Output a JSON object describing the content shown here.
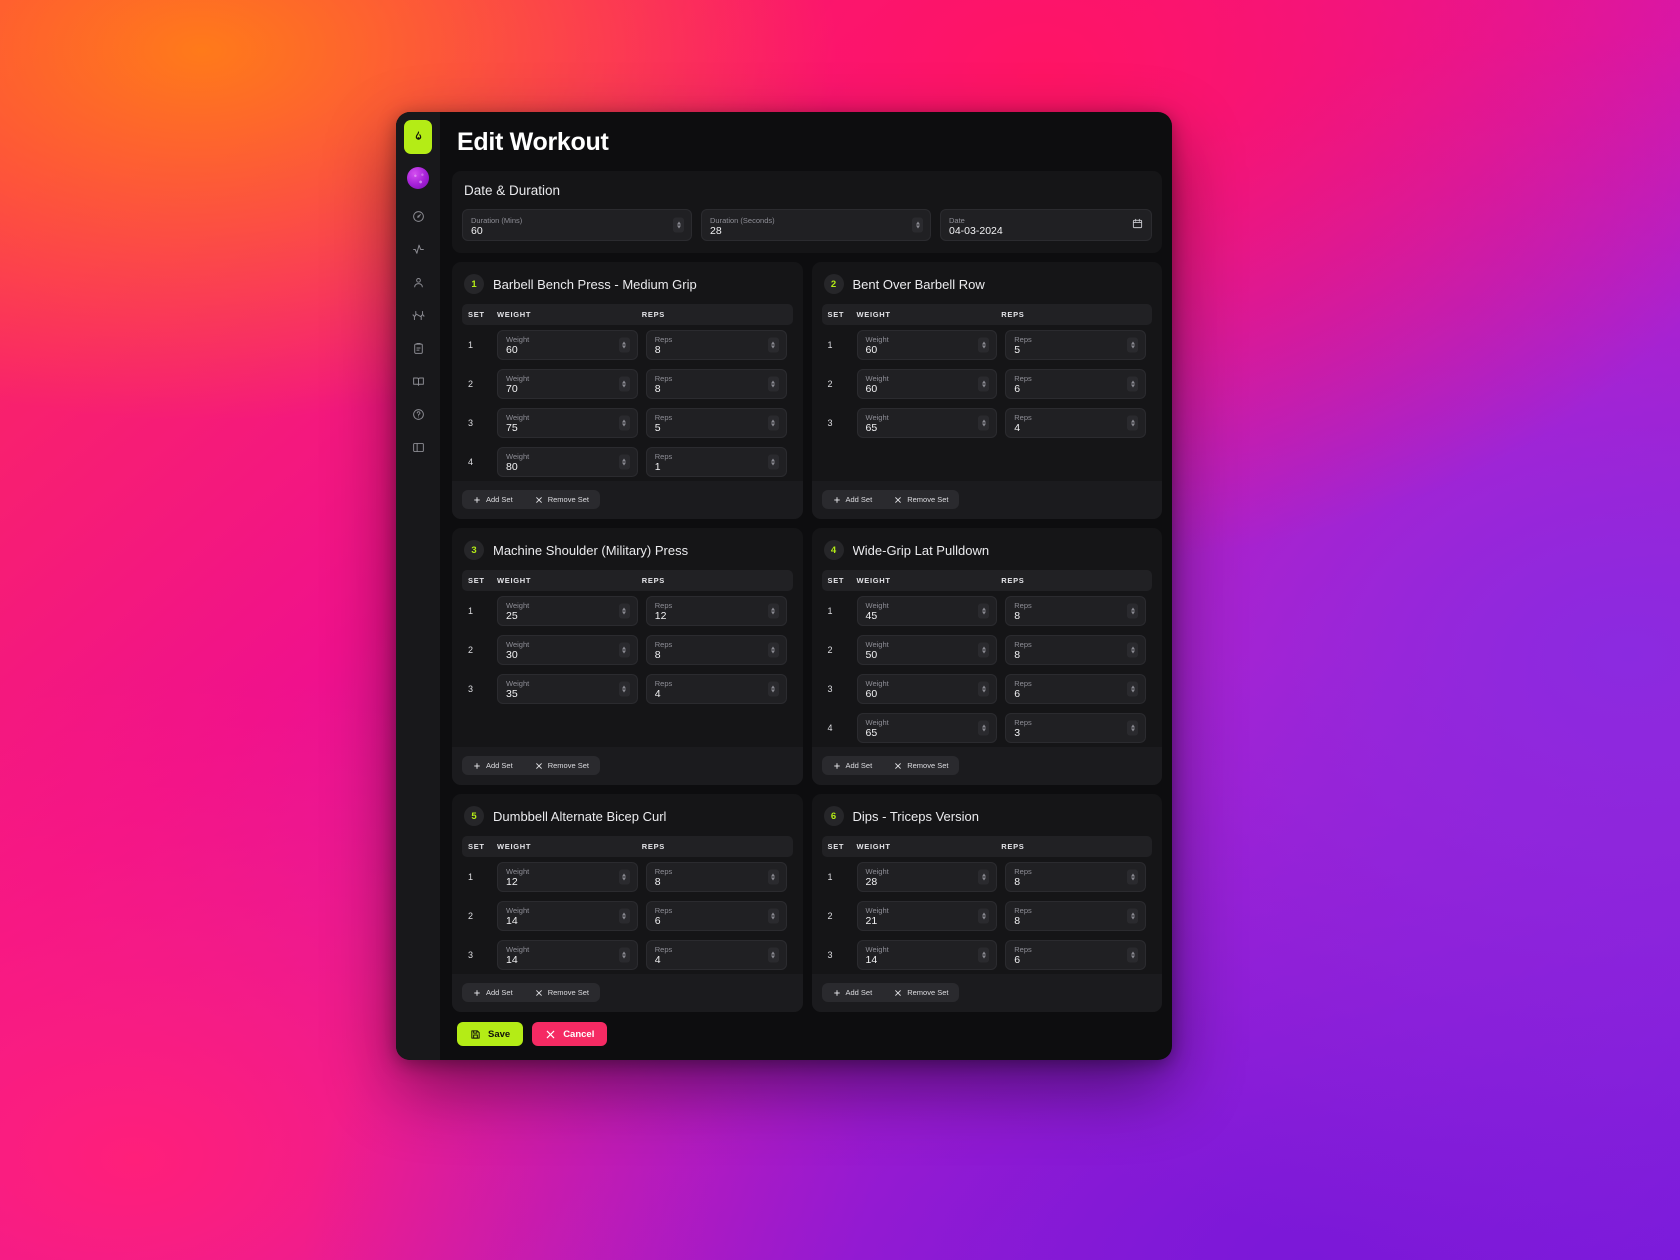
{
  "window": {
    "title": "Edit Workout"
  },
  "sidebar": {
    "logo_icon": "flame-icon",
    "avatar": "user-avatar",
    "items": [
      {
        "icon": "gauge-icon",
        "name": "dashboard"
      },
      {
        "icon": "activity-icon",
        "name": "activity"
      },
      {
        "icon": "person-icon",
        "name": "profile"
      },
      {
        "icon": "dumbbell-icon",
        "name": "workouts"
      },
      {
        "icon": "clipboard-icon",
        "name": "plans"
      },
      {
        "icon": "book-icon",
        "name": "library"
      },
      {
        "icon": "help-icon",
        "name": "help"
      },
      {
        "icon": "panel-icon",
        "name": "panel-toggle"
      }
    ]
  },
  "date_duration": {
    "title": "Date & Duration",
    "fields": [
      {
        "label": "Duration (Mins)",
        "value": "60"
      },
      {
        "label": "Duration (Seconds)",
        "value": "28"
      },
      {
        "label": "Date",
        "value": "04-03-2024"
      }
    ]
  },
  "table_headers": {
    "set": "SET",
    "weight": "WEIGHT",
    "reps": "REPS"
  },
  "input_labels": {
    "weight": "Weight",
    "reps": "Reps"
  },
  "set_actions": {
    "add": "Add Set",
    "remove": "Remove Set"
  },
  "exercises": [
    {
      "number": "1",
      "name": "Barbell Bench Press - Medium Grip",
      "sets": [
        {
          "set": "1",
          "weight": "60",
          "reps": "8"
        },
        {
          "set": "2",
          "weight": "70",
          "reps": "8"
        },
        {
          "set": "3",
          "weight": "75",
          "reps": "5"
        },
        {
          "set": "4",
          "weight": "80",
          "reps": "1"
        }
      ]
    },
    {
      "number": "2",
      "name": "Bent Over Barbell Row",
      "sets": [
        {
          "set": "1",
          "weight": "60",
          "reps": "5"
        },
        {
          "set": "2",
          "weight": "60",
          "reps": "6"
        },
        {
          "set": "3",
          "weight": "65",
          "reps": "4"
        }
      ]
    },
    {
      "number": "3",
      "name": "Machine Shoulder (Military) Press",
      "sets": [
        {
          "set": "1",
          "weight": "25",
          "reps": "12"
        },
        {
          "set": "2",
          "weight": "30",
          "reps": "8"
        },
        {
          "set": "3",
          "weight": "35",
          "reps": "4"
        }
      ]
    },
    {
      "number": "4",
      "name": "Wide-Grip Lat Pulldown",
      "sets": [
        {
          "set": "1",
          "weight": "45",
          "reps": "8"
        },
        {
          "set": "2",
          "weight": "50",
          "reps": "8"
        },
        {
          "set": "3",
          "weight": "60",
          "reps": "6"
        },
        {
          "set": "4",
          "weight": "65",
          "reps": "3"
        }
      ]
    },
    {
      "number": "5",
      "name": "Dumbbell Alternate Bicep Curl",
      "sets": [
        {
          "set": "1",
          "weight": "12",
          "reps": "8"
        },
        {
          "set": "2",
          "weight": "14",
          "reps": "6"
        },
        {
          "set": "3",
          "weight": "14",
          "reps": "4"
        }
      ]
    },
    {
      "number": "6",
      "name": "Dips - Triceps Version",
      "sets": [
        {
          "set": "1",
          "weight": "28",
          "reps": "8"
        },
        {
          "set": "2",
          "weight": "21",
          "reps": "8"
        },
        {
          "set": "3",
          "weight": "14",
          "reps": "6"
        }
      ]
    }
  ],
  "footer": {
    "save_label": "Save",
    "cancel_label": "Cancel"
  },
  "colors": {
    "accent_lime": "#b4ec16",
    "danger_pink": "#f52a63",
    "panel_bg": "#151517",
    "window_bg": "#0d0d0f"
  }
}
